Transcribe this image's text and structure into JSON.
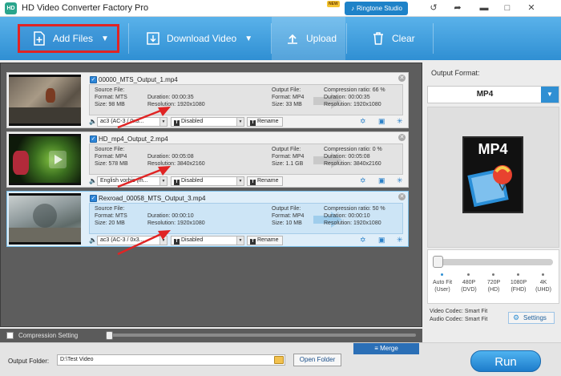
{
  "window": {
    "title": "HD Video Converter Factory Pro",
    "logo_text": "HD",
    "new_badge": "NEW",
    "ringtone_label": "Ringtone Studio"
  },
  "toolbar": {
    "add_files": "Add Files",
    "download_video": "Download Video",
    "upload": "Upload",
    "clear": "Clear"
  },
  "files": [
    {
      "name": "00000_MTS_Output_1.mp4",
      "source_label": "Source File:",
      "source_format": "Format: MTS",
      "source_duration": "Duration: 00:00:35",
      "source_size": "Size: 98 MB",
      "source_resolution": "Resolution: 1920x1080",
      "output_label": "Output File:",
      "output_format": "Format: MP4",
      "output_duration": "Duration: 00:00:35",
      "output_size": "Size: 33 MB",
      "output_resolution": "Resolution: 1920x1080",
      "compression": "Compression ratio: 66 %",
      "audio": "ac3 (AC-3 / 0x3...",
      "subtitle": "Disabled",
      "rename": "Rename"
    },
    {
      "name": "HD_mp4_Output_2.mp4",
      "source_label": "Source File:",
      "source_format": "Format: MP4",
      "source_duration": "Duration: 00:05:08",
      "source_size": "Size: 578 MB",
      "source_resolution": "Resolution: 3840x2160",
      "output_label": "Output File:",
      "output_format": "Format: MP4",
      "output_duration": "Duration: 00:05:08",
      "output_size": "Size: 1.1 GB",
      "output_resolution": "Resolution: 3840x2160",
      "compression": "Compression ratio: 0 %",
      "audio": "English vorbis (m...",
      "subtitle": "Disabled",
      "rename": "Rename"
    },
    {
      "name": "Rexroad_00058_MTS_Output_3.mp4",
      "source_label": "Source File:",
      "source_format": "Format: MTS",
      "source_duration": "Duration: 00:00:10",
      "source_size": "Size: 20 MB",
      "source_resolution": "Resolution: 1920x1080",
      "output_label": "Output File:",
      "output_format": "Format: MP4",
      "output_duration": "Duration: 00:00:10",
      "output_size": "Size: 10 MB",
      "output_resolution": "Resolution: 1920x1080",
      "compression": "Compression ratio: 50 %",
      "audio": "ac3 (AC-3 / 0x3...",
      "subtitle": "Disabled",
      "rename": "Rename"
    }
  ],
  "right_panel": {
    "output_format_label": "Output Format:",
    "format_value": "MP4",
    "format_icon_text": "MP4",
    "quality_levels": [
      {
        "main": "Auto Fit",
        "sub": "(User)"
      },
      {
        "main": "480P",
        "sub": "(DVD)"
      },
      {
        "main": "720P",
        "sub": "(HD)"
      },
      {
        "main": "1080P",
        "sub": "(FHD)"
      },
      {
        "main": "4K",
        "sub": "(UHD)"
      }
    ],
    "video_codec": "Video Codec: Smart Fit",
    "audio_codec": "Audio Codec: Smart Fit",
    "settings": "Settings"
  },
  "compression": {
    "label": "Compression Setting"
  },
  "bottom": {
    "merge": "Merge",
    "output_folder_label": "Output Folder:",
    "output_folder_value": "D:\\Test Video",
    "open_folder": "Open Folder",
    "run": "Run"
  },
  "colors": {
    "accent": "#2f8fd3",
    "highlight_box": "#e02424",
    "annotation_arrow": "#e02424"
  }
}
